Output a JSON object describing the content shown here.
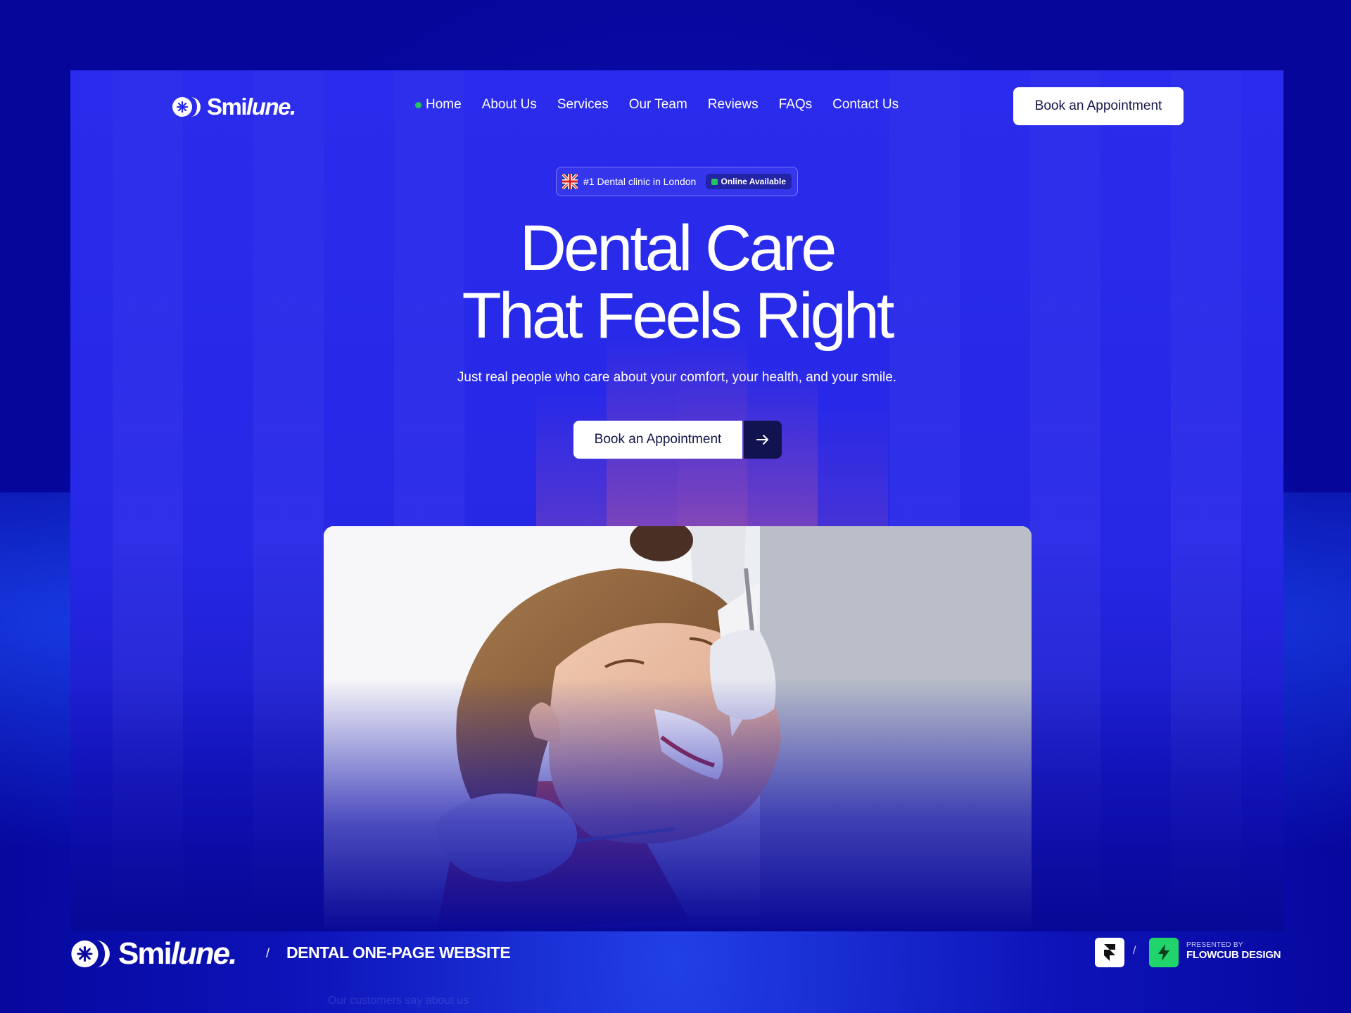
{
  "brand": {
    "name_prefix": "Smi",
    "name_suffix": "lune."
  },
  "nav": {
    "items": [
      {
        "label": "Home",
        "active": true
      },
      {
        "label": "About Us"
      },
      {
        "label": "Services"
      },
      {
        "label": "Our Team"
      },
      {
        "label": "Reviews"
      },
      {
        "label": "FAQs"
      },
      {
        "label": "Contact Us"
      }
    ],
    "cta_label": "Book an Appointment"
  },
  "badge": {
    "flag_icon": "uk-flag-icon",
    "text": "#1 Dental clinic in London",
    "status": "Online Available",
    "status_color": "#22c55e"
  },
  "hero": {
    "title_line1": "Dental Care",
    "title_line2": "That Feels Right",
    "subtitle": "Just real people who care about your comfort, your health, and your smile.",
    "cta_label": "Book an Appointment",
    "cta_icon": "arrow-right-icon"
  },
  "footer": {
    "separator": "/",
    "tagline": "DENTAL ONE-PAGE WEBSITE",
    "tool_separator": "/",
    "presented_by": "PRESENTED BY",
    "studio": "FLOWCUB DESIGN",
    "hidden_text": "Our customers say about us"
  },
  "colors": {
    "page_bg": "#0a0a9e",
    "frame_bg": "#2a2bec",
    "accent_dark": "#111350",
    "active_dot": "#22c55e",
    "studio_green": "#21d36b"
  }
}
